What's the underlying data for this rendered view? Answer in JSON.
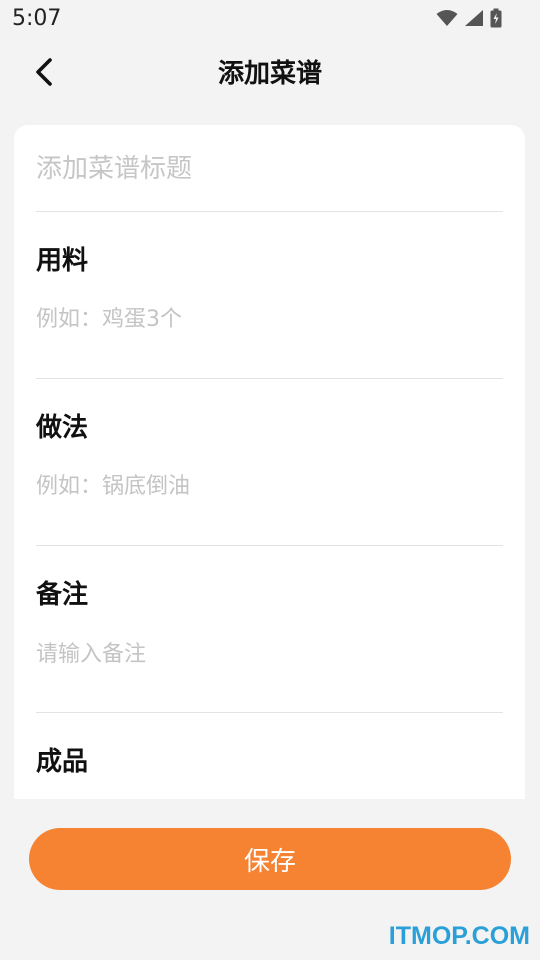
{
  "status_bar": {
    "time": "5:07",
    "icons": [
      "wifi-icon",
      "cell-signal-icon",
      "battery-icon"
    ]
  },
  "app_bar": {
    "back_icon": "chevron-left-icon",
    "title": "添加菜谱"
  },
  "form": {
    "title_placeholder": "添加菜谱标题",
    "ingredients_label": "用料",
    "ingredients_placeholder": "例如：鸡蛋3个",
    "method_label": "做法",
    "method_placeholder": "例如：锅底倒油",
    "notes_label": "备注",
    "notes_placeholder": "请输入备注",
    "result_label": "成品"
  },
  "actions": {
    "save_label": "保存"
  },
  "watermark": "ITMOP.COM",
  "colors": {
    "accent": "#f68332",
    "background": "#f3f3f3",
    "card": "#ffffff",
    "placeholder": "#c4c4c4",
    "watermark": "#2a9fd8"
  }
}
